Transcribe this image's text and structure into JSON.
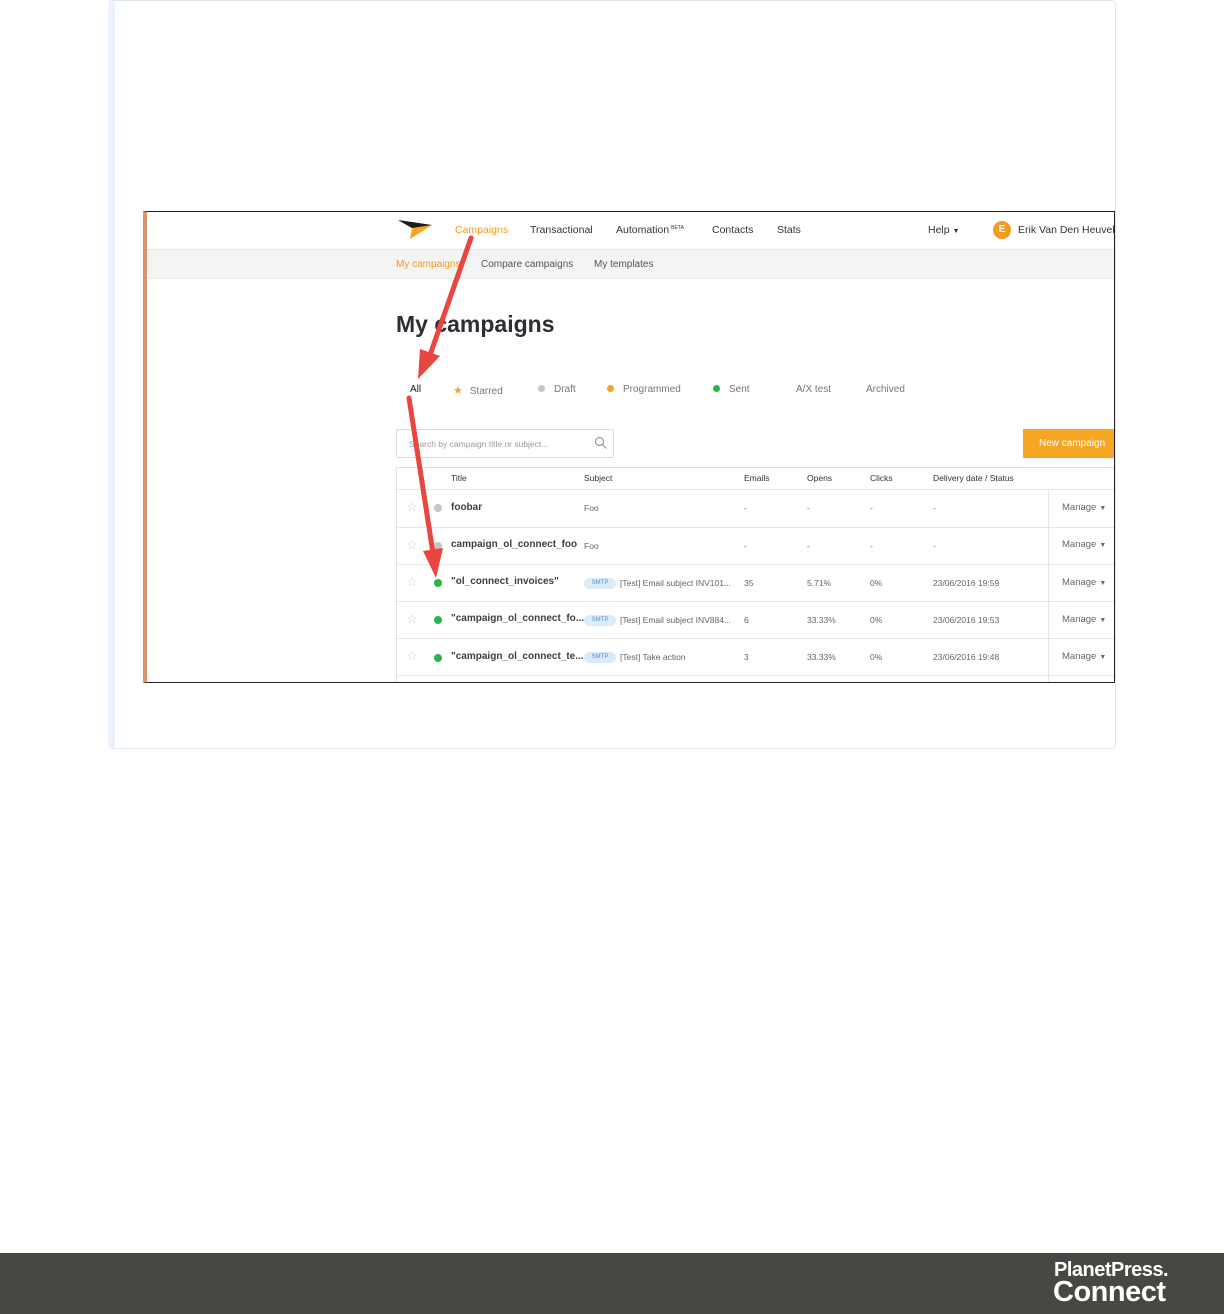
{
  "nav": {
    "items": [
      "Campaigns",
      "Transactional",
      "Automation",
      "Contacts",
      "Stats"
    ],
    "automation_badge": "BETA",
    "help": "Help",
    "user_initial": "E",
    "user_name": "Erik Van Den Heuvel"
  },
  "subnav": [
    "My campaigns",
    "Compare campaigns",
    "My templates"
  ],
  "page_title": "My campaigns",
  "filters": [
    "All",
    "Starred",
    "Draft",
    "Programmed",
    "Sent",
    "A/X test",
    "Archived"
  ],
  "search": {
    "placeholder": "Search by campaign title or subject..."
  },
  "new_campaign": "New campaign",
  "table": {
    "headers": [
      "Title",
      "Subject",
      "Emails",
      "Opens",
      "Clicks",
      "Delivery date / Status"
    ],
    "smtp_badge": "SMTP",
    "manage_label": "Manage",
    "rows": [
      {
        "status": "draft",
        "title": "foobar",
        "subject": "Foo",
        "emails": "-",
        "opens": "-",
        "clicks": "-",
        "date": "-"
      },
      {
        "status": "draft",
        "title": "campaign_ol_connect_foo",
        "subject": "Foo",
        "emails": "-",
        "opens": "-",
        "clicks": "-",
        "date": "-"
      },
      {
        "status": "sent",
        "title": "\"ol_connect_invoices\"",
        "subject": "[Test] Email subject INV101...",
        "emails": "35",
        "opens": "5.71%",
        "clicks": "0%",
        "date": "23/06/2016 19:59"
      },
      {
        "status": "sent",
        "title": "\"campaign_ol_connect_fo...",
        "subject": "[Test] Email subject INV884...",
        "emails": "6",
        "opens": "33.33%",
        "clicks": "0%",
        "date": "23/06/2016 19:53"
      },
      {
        "status": "sent",
        "title": "\"campaign_ol_connect_te...",
        "subject": "[Test] Take action",
        "emails": "3",
        "opens": "33.33%",
        "clicks": "0%",
        "date": "23/06/2016 19:48"
      }
    ]
  },
  "colors": {
    "accent": "#f6a623",
    "sent": "#2eb34a",
    "draft": "#c6c6c6",
    "annotation": "#e8463e",
    "footer": "#474844"
  },
  "footer": {
    "brand_line1": "PlanetPress.",
    "brand_line2": "Connect"
  }
}
